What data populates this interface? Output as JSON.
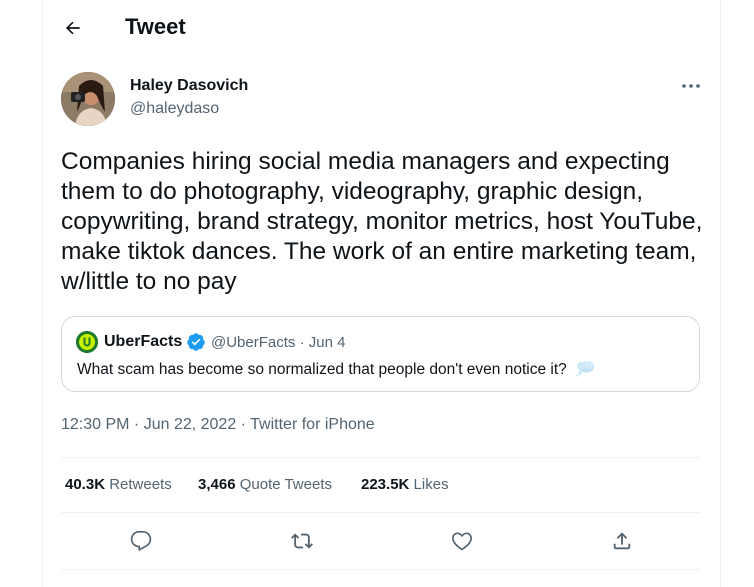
{
  "header": {
    "title": "Tweet"
  },
  "author": {
    "name": "Haley Dasovich",
    "handle": "@haleydaso"
  },
  "tweet": {
    "text": "Companies hiring social media managers and expecting them to do photography, videography, graphic design, copywriting, brand strategy, monitor metrics, host YouTube, make tiktok dances. The work of an entire marketing team, w/little to no pay"
  },
  "quote": {
    "name": "UberFacts",
    "handle_date": "@UberFacts · Jun 4",
    "text": "What scam has become so normalized that people don't even notice it?",
    "emoji_icon": "thought-bubble-icon"
  },
  "meta": {
    "timestamp": "12:30 PM · Jun 22, 2022 · Twitter for iPhone"
  },
  "stats": {
    "retweets_count": "40.3K",
    "retweets_label": "Retweets",
    "quotes_count": "3,466",
    "quotes_label": "Quote Tweets",
    "likes_count": "223.5K",
    "likes_label": "Likes"
  },
  "icons": {
    "back": "arrow-left-icon",
    "more": "more-horizontal-icon",
    "verified": "verified-badge-icon",
    "reply": "reply-icon",
    "retweet": "retweet-icon",
    "like": "heart-icon",
    "share": "share-icon"
  },
  "colors": {
    "text": "#0f1419",
    "secondary": "#536471",
    "border": "#cfd9de",
    "verified": "#1d9bf0",
    "uberfacts_green": "#1f7a2e",
    "uberfacts_yellow": "#c6f000"
  }
}
